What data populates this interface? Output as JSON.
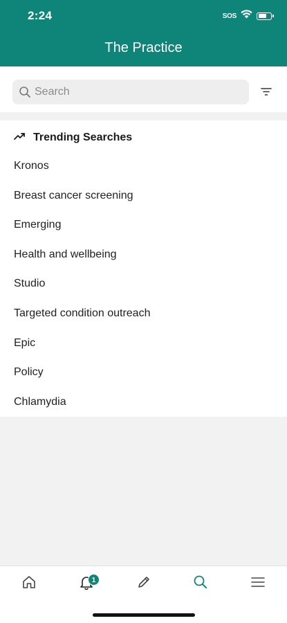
{
  "status_bar": {
    "time": "2:24",
    "sos_label": "SOS",
    "battery_level": 0.7
  },
  "header": {
    "title": "The Practice"
  },
  "search": {
    "placeholder": "Search",
    "value": "",
    "icon": "search-icon",
    "filter_icon": "filter-icon"
  },
  "trending": {
    "title": "Trending Searches",
    "icon": "trending-up-icon",
    "items": [
      "Kronos",
      "Breast cancer screening",
      "Emerging",
      "Health and wellbeing",
      "Studio",
      "Targeted condition outreach",
      "Epic",
      "Policy",
      "Chlamydia"
    ]
  },
  "bottom_nav": {
    "items": [
      {
        "icon": "home-icon",
        "active": false
      },
      {
        "icon": "bell-icon",
        "active": false,
        "badge": "1"
      },
      {
        "icon": "pencil-icon",
        "active": false
      },
      {
        "icon": "search-icon",
        "active": true
      },
      {
        "icon": "menu-icon",
        "active": false
      }
    ]
  },
  "colors": {
    "brand": "#0e8578",
    "background": "#f2f2f2",
    "surface": "#ffffff",
    "inactive_icon": "#444444"
  }
}
